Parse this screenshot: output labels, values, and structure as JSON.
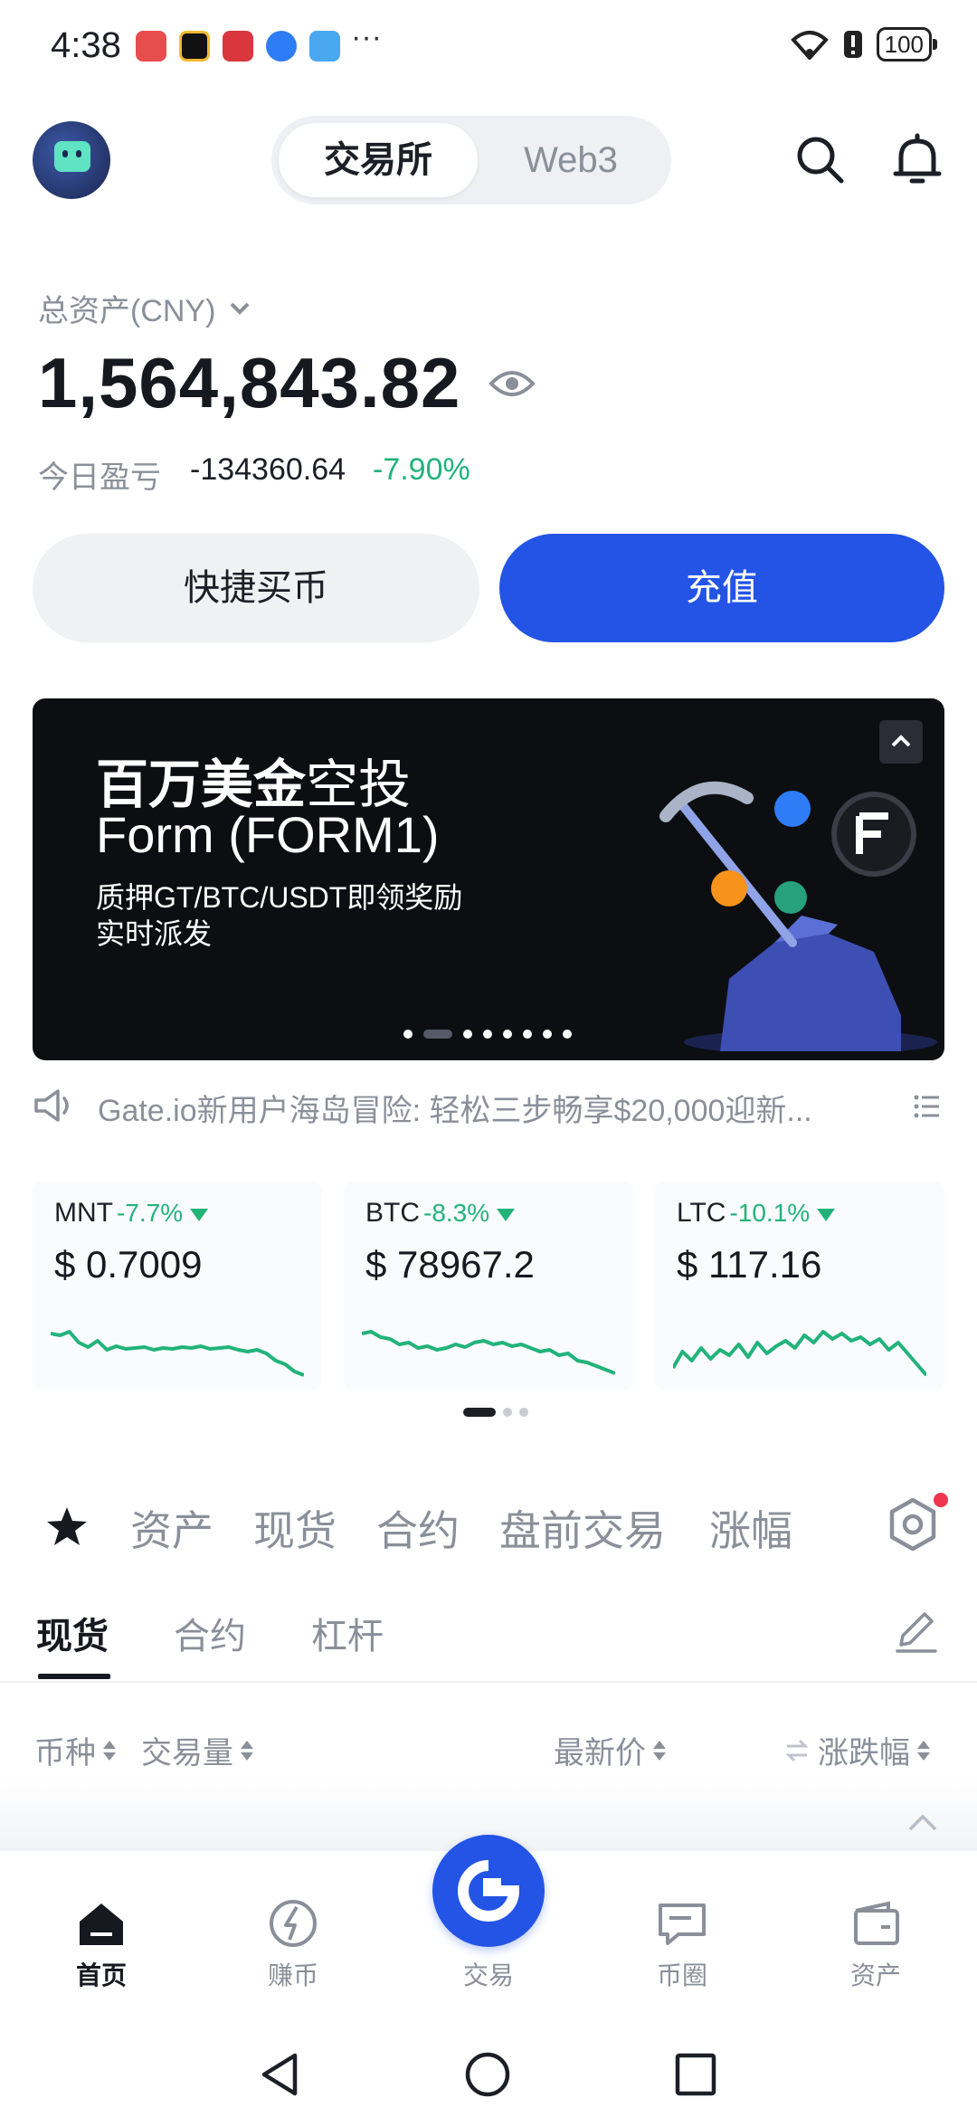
{
  "status_bar": {
    "time": "4:38",
    "more": "···",
    "battery": "100"
  },
  "header": {
    "segments": [
      "交易所",
      "Web3"
    ],
    "active_segment": "交易所"
  },
  "assets": {
    "label": "总资产(CNY)",
    "value": "1,564,843.82",
    "pnl_label": "今日盈亏",
    "pnl_value": "-134360.64",
    "pnl_pct": "-7.90%"
  },
  "actions": {
    "quick_buy": "快捷买币",
    "deposit": "充值"
  },
  "banner": {
    "title_bold": "百万美金",
    "title_rest": "空投",
    "subtitle": "Form (FORM1)",
    "desc": "质押GT/BTC/USDT即领奖励实时派发"
  },
  "announcement": {
    "text": "Gate.io新用户海岛冒险: 轻松三步畅享$20,000迎新..."
  },
  "tickers": [
    {
      "symbol": "MNT",
      "change": "-7.7%",
      "price": "$ 0.7009",
      "spark": [
        40,
        42,
        38,
        50,
        55,
        48,
        58,
        54,
        57,
        56,
        55,
        58,
        56,
        57,
        55,
        56,
        54,
        57,
        56,
        55,
        58,
        60,
        58,
        62,
        70,
        74,
        82,
        86
      ]
    },
    {
      "symbol": "BTC",
      "change": "-8.3%",
      "price": "$ 78967.2",
      "spark": [
        40,
        38,
        44,
        46,
        52,
        50,
        56,
        54,
        58,
        56,
        52,
        55,
        50,
        48,
        52,
        50,
        54,
        52,
        56,
        60,
        58,
        64,
        62,
        70,
        72,
        76,
        80,
        84
      ]
    },
    {
      "symbol": "LTC",
      "change": "-10.1%",
      "price": "$ 117.16",
      "spark": [
        78,
        60,
        70,
        56,
        68,
        58,
        64,
        52,
        66,
        50,
        62,
        54,
        48,
        56,
        42,
        50,
        38,
        46,
        40,
        48,
        44,
        52,
        46,
        58,
        50,
        62,
        74,
        86
      ]
    }
  ],
  "tabs_primary": [
    "资产",
    "现货",
    "合约",
    "盘前交易",
    "涨幅"
  ],
  "tabs_secondary": [
    "现货",
    "合约",
    "杠杆"
  ],
  "columns": {
    "coin": "币种",
    "volume": "交易量",
    "last_price": "最新价",
    "change": "涨跌幅"
  },
  "bottom_nav": [
    "首页",
    "赚币",
    "交易",
    "币圈",
    "资产"
  ],
  "colors": {
    "accent": "#2354e6",
    "down": "#22b37b",
    "text": "#1c1f26",
    "muted": "#8a8f99"
  }
}
